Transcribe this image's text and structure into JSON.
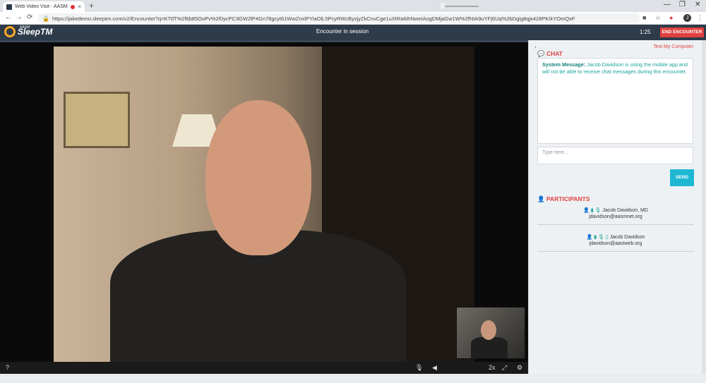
{
  "browser": {
    "tab_title": "Web Video Visit - AASM Sle",
    "tab_close": "×",
    "new_tab": "+",
    "url": "https://jakedemo.sleeptm.com/v2/Encounter?q=KTtlT%2f6b85OoPv%2f0ycPC3GW2lP4Gn78gcyt61WwZnxlPYiaOlL5PcyRWcByzjyZkCnvCge1uXtRa6ihNweIAogDMjaGw1W%2fNIA9uYFj6Uq%2bDgig8qjx428PKIkYOmQxF",
    "lock_icon": "🔒",
    "back": "←",
    "forward": "→",
    "reload": "⟳",
    "profile_initial": "J",
    "win_min": "—",
    "win_max": "❐",
    "win_close": "✕"
  },
  "header": {
    "logo_text": "SleepTM",
    "logo_sup": "AASM",
    "status": "Encounter in session",
    "timer": "1:25",
    "end_button": "END ENCOUNTER"
  },
  "controls": {
    "help": "?",
    "mic": "🎙",
    "volume": "◀",
    "zoom": "2x",
    "fullscreen": "⤢",
    "settings": "⚙"
  },
  "panel": {
    "collapse": "›",
    "test_link": "Test My Computer",
    "chat_title": "CHAT",
    "system_label": "System Message",
    "system_text": "Jacob Davidson is using the mobile app and will not be able to receive chat messages during this encounter.",
    "input_placeholder": "Type here...",
    "send_button": "SEND",
    "participants_title": "PARTICIPANTS",
    "participants": [
      {
        "icons": "👤 ▮ 🎙",
        "name": "Jacob Davidson, MD",
        "email": "jdavidson@aasmnet.org"
      },
      {
        "icons": "👤 ▮ 🎙 ▯",
        "name": "Jacob Davidson",
        "email": "jdavidson@aastweb.org"
      }
    ]
  }
}
